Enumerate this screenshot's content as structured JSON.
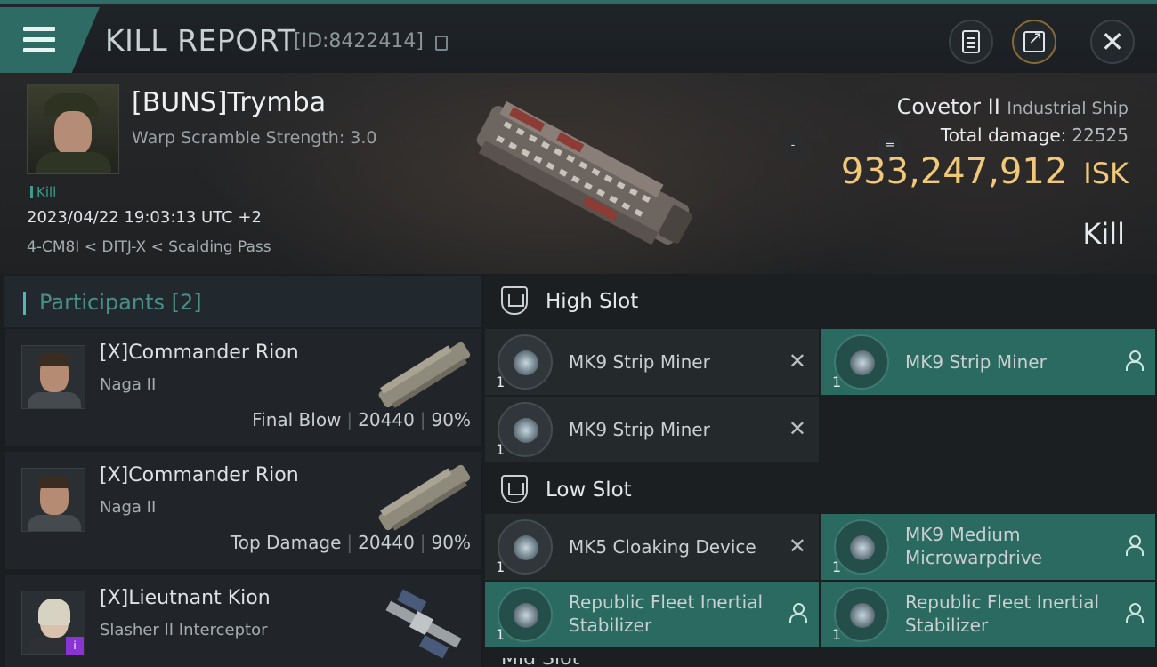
{
  "header": {
    "title": "KILL REPORT",
    "report_id": "[ID:8422414]"
  },
  "victim": {
    "name": "[BUNS]Trymba",
    "warp_scramble": "Warp Scramble Strength: 3.0",
    "tag": "Kill",
    "datetime": "2023/04/22 19:03:13 UTC +2",
    "location": "4-CM8I < DITJ-X < Scalding Pass",
    "ship_name": "Covetor II",
    "ship_class": "Industrial Ship",
    "total_damage_label": "Total damage:",
    "total_damage_value": "22525",
    "isk_value": "933,247,912",
    "isk_unit": "ISK",
    "result": "Kill",
    "marker_a": "-",
    "marker_b": "="
  },
  "participants": {
    "label": "Participants",
    "count": "[2]",
    "items": [
      {
        "name": "[X]Commander Rion",
        "ship": "Naga II",
        "role": "Final Blow",
        "damage": "20440",
        "percent": "90%"
      },
      {
        "name": "[X]Commander Rion",
        "ship": "Naga II",
        "role": "Top Damage",
        "damage": "20440",
        "percent": "90%"
      },
      {
        "name": "[X]Lieutnant Kion",
        "ship": "Slasher II Interceptor",
        "badge": "i"
      }
    ]
  },
  "high_slot": {
    "label": "High Slot",
    "modules": [
      {
        "name": "MK9 Strip Miner",
        "qty": "1"
      },
      {
        "name": "MK9 Strip Miner",
        "qty": "1"
      },
      {
        "name": "MK9 Strip Miner",
        "qty": "1"
      }
    ]
  },
  "low_slot": {
    "label": "Low Slot",
    "modules": [
      {
        "name": "MK5 Cloaking Device",
        "qty": "1"
      },
      {
        "name_line1": "MK9 Medium",
        "name_line2": "Microwarpdrive",
        "qty": "1"
      },
      {
        "name_line1": "Republic Fleet Inertial",
        "name_line2": "Stabilizer",
        "qty": "1"
      },
      {
        "name_line1": "Republic Fleet Inertial",
        "name_line2": "Stabilizer",
        "qty": "1"
      }
    ]
  },
  "next_slot_partial": "Mid Slot",
  "colors": {
    "accent_teal": "#2d6b64",
    "isk_gold": "#f0c878",
    "insured_bg": "#2b6a61"
  }
}
